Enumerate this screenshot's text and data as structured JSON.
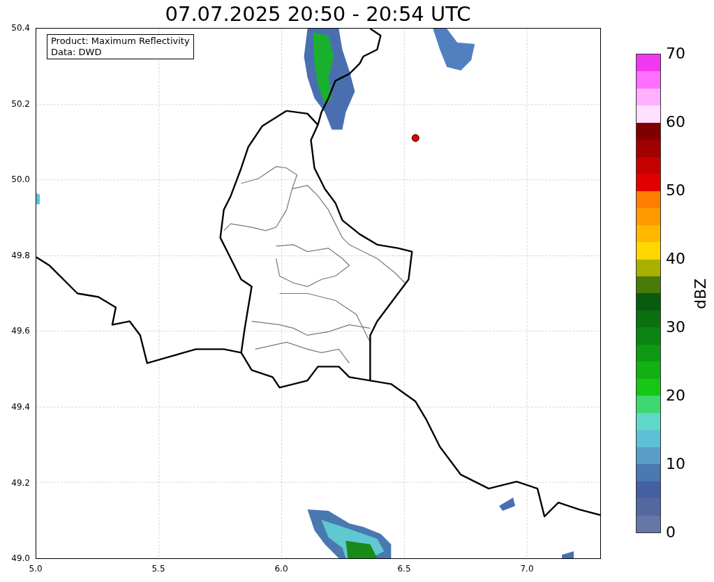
{
  "title": "07.07.2025 20:50 - 20:54 UTC",
  "legend": [
    "Product: Maximum Reflectivity",
    "Data: DWD"
  ],
  "x_ticks": [
    "5.0",
    "5.5",
    "6.0",
    "6.5",
    "7.0"
  ],
  "y_ticks": [
    "50.4",
    "50.2",
    "50.0",
    "49.8",
    "49.6",
    "49.4",
    "49.2",
    "49.0"
  ],
  "colorbar": {
    "label": "dBZ",
    "ticks": [
      "70",
      "60",
      "50",
      "40",
      "30",
      "20",
      "10",
      "0"
    ],
    "segments": [
      {
        "color": "#6577a6"
      },
      {
        "color": "#5468a0"
      },
      {
        "color": "#4560a0"
      },
      {
        "color": "#4a78b0"
      },
      {
        "color": "#5a9ec8"
      },
      {
        "color": "#5fbfd8"
      },
      {
        "color": "#60d8c8"
      },
      {
        "color": "#3fd870"
      },
      {
        "color": "#14c814"
      },
      {
        "color": "#12b012"
      },
      {
        "color": "#0e9a12"
      },
      {
        "color": "#0a8410"
      },
      {
        "color": "#0a7010"
      },
      {
        "color": "#085c10"
      },
      {
        "color": "#4a7a08"
      },
      {
        "color": "#aab000"
      },
      {
        "color": "#ffd800"
      },
      {
        "color": "#ffb800"
      },
      {
        "color": "#ff9a00"
      },
      {
        "color": "#ff7e00"
      },
      {
        "color": "#e00000"
      },
      {
        "color": "#c40000"
      },
      {
        "color": "#a00000"
      },
      {
        "color": "#800000"
      },
      {
        "color": "#ffe0ff"
      },
      {
        "color": "#ffb0ff"
      },
      {
        "color": "#ff70ff"
      },
      {
        "color": "#f038f0"
      }
    ]
  }
}
